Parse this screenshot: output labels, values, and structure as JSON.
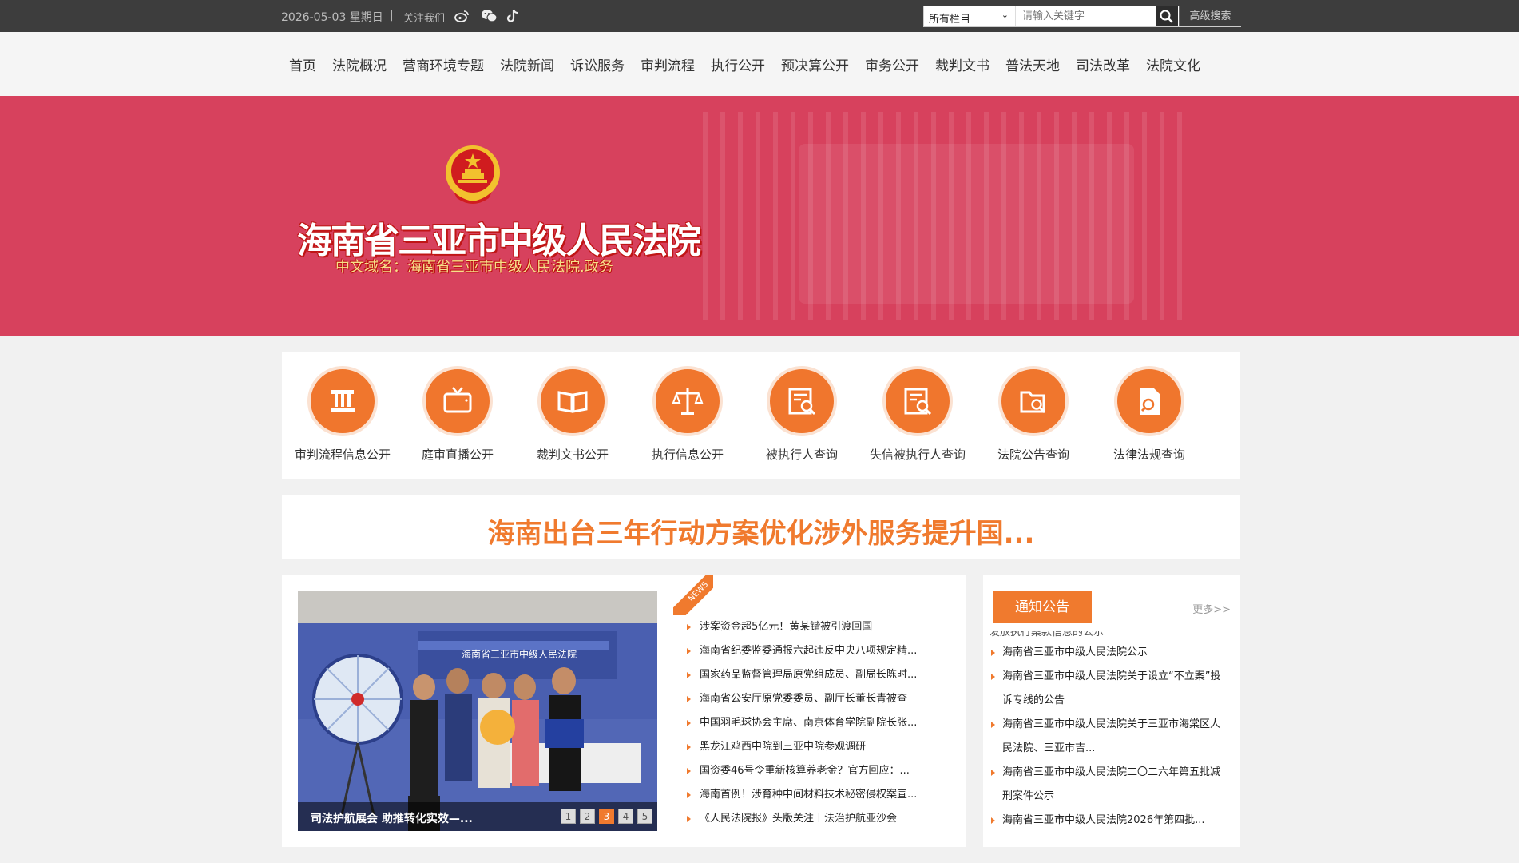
{
  "topbar": {
    "date": "2026-05-03 星期日",
    "separator": "|",
    "follow_label": "关注我们",
    "search": {
      "scope_selected": "所有栏目",
      "placeholder": "请输入关键字",
      "advanced_label": "高级搜索"
    }
  },
  "nav": {
    "items": [
      "首页",
      "法院概况",
      "营商环境专题",
      "法院新闻",
      "诉讼服务",
      "审判流程",
      "执行公开",
      "预决算公开",
      "审务公开",
      "裁判文书",
      "普法天地",
      "司法改革",
      "法院文化"
    ]
  },
  "banner": {
    "court_name": "海南省三亚市中级人民法院",
    "domain_text": "中文域名：海南省三亚市中级人民法院.政务"
  },
  "services": [
    {
      "label": "审判流程信息公开",
      "icon": "pillar-icon"
    },
    {
      "label": "庭审直播公开",
      "icon": "tv-icon"
    },
    {
      "label": "裁判文书公开",
      "icon": "book-icon"
    },
    {
      "label": "执行信息公开",
      "icon": "scales-icon"
    },
    {
      "label": "被执行人查询",
      "icon": "document-search-icon"
    },
    {
      "label": "失信被执行人查询",
      "icon": "document-search-icon"
    },
    {
      "label": "法院公告查询",
      "icon": "folder-search-icon"
    },
    {
      "label": "法律法规查询",
      "icon": "file-search-icon"
    }
  ],
  "headline": "海南出台三年行动方案优化涉外服务提升国...",
  "slideshow": {
    "caption": "司法护航展会 助推转化实效—...",
    "pages": [
      "1",
      "2",
      "3",
      "4",
      "5"
    ],
    "active_page": 3,
    "photo_banner_text": "海南省三亚市中级人民法院"
  },
  "news_ribbon": "NEWS",
  "news": [
    "涉案资金超5亿元！黄某锴被引渡回国",
    "海南省纪委监委通报六起违反中央八项规定精...",
    "国家药品监督管理局原党组成员、副局长陈时...",
    "海南省公安厅原党委委员、副厅长董长青被查",
    "中国羽毛球协会主席、南京体育学院副院长张...",
    "黑龙江鸡西中院到三亚中院参观调研",
    "国资委46号令重新核算养老金？官方回应：...",
    "海南首例！涉育种中间材料技术秘密侵权案宣...",
    "《人民法院报》头版关注丨法治护航亚沙会"
  ],
  "notice": {
    "tab_label": "通知公告",
    "more_label": "更多>>",
    "first_line": "发放执行案款信息的公示",
    "items": [
      "海南省三亚市中级人民法院公示",
      "海南省三亚市中级人民法院关于设立“不立案”投诉专线的公告",
      "海南省三亚市中级人民法院关于三亚市海棠区人民法院、三亚市吉...",
      "海南省三亚市中级人民法院二〇二六年第五批减刑案件公示",
      "海南省三亚市中级人民法院2026年第四批..."
    ]
  },
  "colors": {
    "accent": "#f07a2e",
    "banner": "#d7415d",
    "topbar": "#3d3d3d"
  }
}
